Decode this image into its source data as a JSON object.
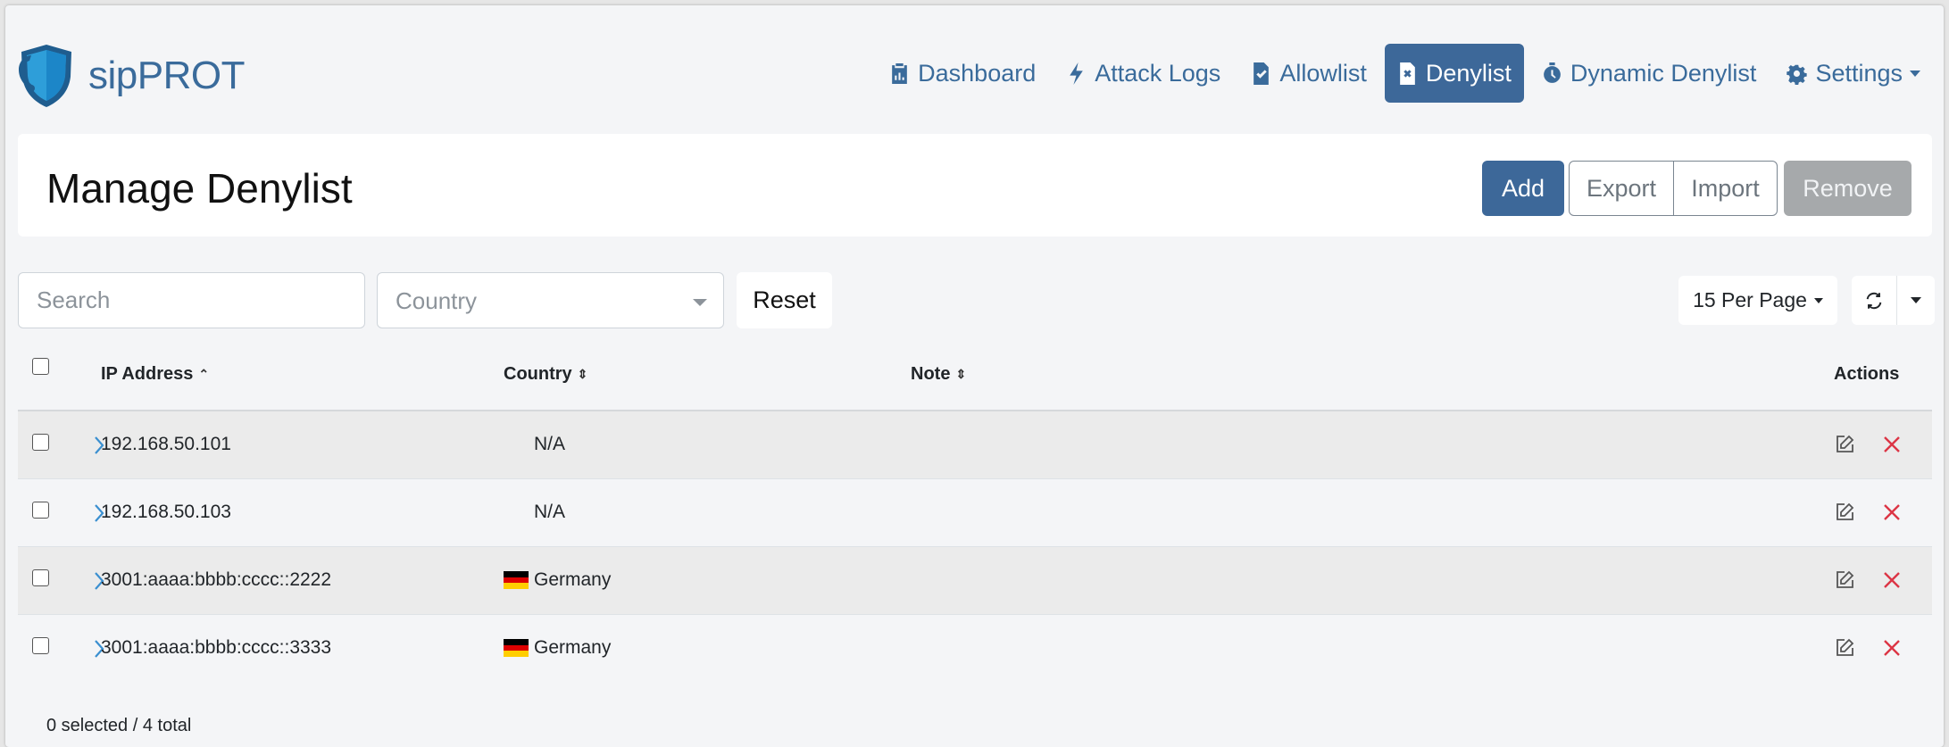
{
  "app": {
    "brand": "sipPROT"
  },
  "nav": {
    "items": [
      {
        "label": "Dashboard",
        "icon": "clipboard-chart-icon"
      },
      {
        "label": "Attack Logs",
        "icon": "bolt-icon"
      },
      {
        "label": "Allowlist",
        "icon": "file-check-icon"
      },
      {
        "label": "Denylist",
        "icon": "file-x-icon",
        "active": true
      },
      {
        "label": "Dynamic Denylist",
        "icon": "stopwatch-icon"
      },
      {
        "label": "Settings",
        "icon": "gear-icon"
      }
    ]
  },
  "page": {
    "title": "Manage Denylist",
    "buttons": {
      "add": "Add",
      "export": "Export",
      "import": "Import",
      "remove": "Remove"
    }
  },
  "filters": {
    "search_placeholder": "Search",
    "country_placeholder": "Country",
    "reset": "Reset",
    "per_page": "15 Per Page"
  },
  "table": {
    "columns": {
      "ip": "IP Address",
      "country": "Country",
      "note": "Note",
      "actions": "Actions"
    },
    "rows": [
      {
        "ip": "192.168.50.101",
        "country": "N/A",
        "flag": "",
        "note": ""
      },
      {
        "ip": "192.168.50.103",
        "country": "N/A",
        "flag": "",
        "note": ""
      },
      {
        "ip": "3001:aaaa:bbbb:cccc::2222",
        "country": "Germany",
        "flag": "de",
        "note": ""
      },
      {
        "ip": "3001:aaaa:bbbb:cccc::3333",
        "country": "Germany",
        "flag": "de",
        "note": ""
      }
    ]
  },
  "footer": {
    "summary": "0 selected / 4 total"
  },
  "colors": {
    "primary": "#3d6899",
    "danger": "#dc3545",
    "muted": "#a6a9ab"
  }
}
